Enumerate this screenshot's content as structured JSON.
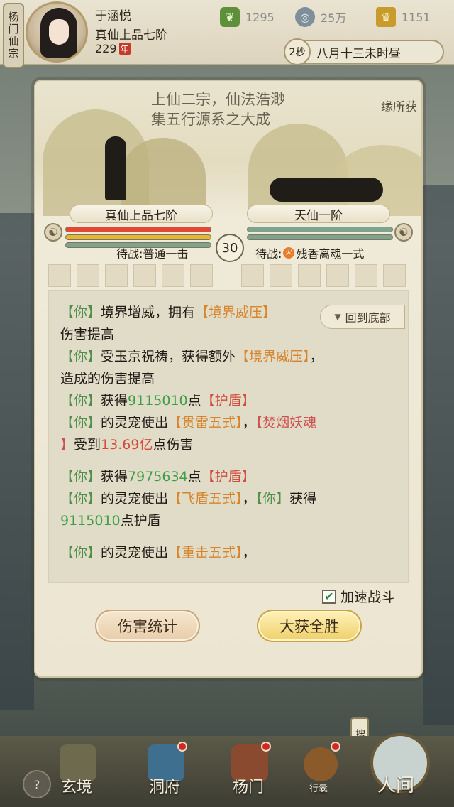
{
  "header": {
    "sect_tag": "杨门仙宗",
    "player_name": "于涵悦",
    "player_rank": "真仙上品七阶",
    "player_age": "229",
    "player_age_unit": "年",
    "resources": [
      {
        "icon": "leaf-icon",
        "value": "1295"
      },
      {
        "icon": "coin-icon",
        "value": "25万"
      },
      {
        "icon": "ingot-icon",
        "value": "1151"
      }
    ],
    "speed_label": "2秒",
    "game_time": "八月十三未时昼"
  },
  "battle": {
    "scene_title_1": "上仙二宗，仙法浩渺",
    "scene_title_2": "集五行源系之大成",
    "scene_side_text": "缘所获",
    "left_fighter": "真仙上品七阶",
    "right_fighter": "天仙一阶",
    "round": "30",
    "left_pending": "待战:普通一击",
    "right_pending_prefix": "待战:",
    "right_pending_icon": "火",
    "right_pending_skill": "残香离魂一式",
    "colors": {
      "hp_red": "#e04a34",
      "hp_yellow": "#e8b530",
      "mp_green": "#7fa48e",
      "log_green": "#4f8f4a",
      "log_orange": "#d7852c",
      "log_red": "#cf5050"
    }
  },
  "log": {
    "back_to_bottom": "回到底部",
    "l1_you": "【你】",
    "l1_text": "境界增威，拥有",
    "l1_skill": "【境界威压】",
    "l2_text": "伤害提高",
    "l3_you": "【你】",
    "l3_text": "受玉京祝祷，获得额外",
    "l3_skill": "【境界威压】",
    "l3_end": "，",
    "l4_text": "造成的伤害提高",
    "l5_you": "【你】",
    "l5_text": "获得",
    "l5_num": "9115010",
    "l5_text2": "点",
    "l5_shield": "【护盾】",
    "l6_you": "【你】",
    "l6_text": "的灵宠使出",
    "l6_skill": "【贯雷五式】",
    "l6_sep": "，",
    "l6_enemy": "【焚烟妖魂",
    "l7_enemy": "】",
    "l7_text": "受到",
    "l7_num": "13.69亿",
    "l7_text2": "点伤害",
    "l8_you": "【你】",
    "l8_text": "获得",
    "l8_num": "7975634",
    "l8_text2": "点",
    "l8_shield": "【护盾】",
    "l9_you": "【你】",
    "l9_text": "的灵宠使出",
    "l9_skill": "【飞盾五式】",
    "l9_sep": "，",
    "l9_you2": "【你】",
    "l9_text2": "获得",
    "l10_num": "9115010",
    "l10_text": "点护盾",
    "l11_you": "【你】",
    "l11_text": "的灵宠使出",
    "l11_skill": "【重击五式】",
    "l11_sep": "，"
  },
  "controls": {
    "speed_label": "加速战斗",
    "speed_checked": true,
    "damage_stats": "伤害统计",
    "victory": "大获全胜"
  },
  "bottom_nav": {
    "search_tag": "搜救中",
    "items": [
      {
        "label": "玄境",
        "icon": "mystic-realm-icon"
      },
      {
        "label": "洞府",
        "icon": "cave-dwelling-icon"
      },
      {
        "label": "杨门",
        "icon": "sect-gate-icon"
      },
      {
        "label": "行囊",
        "icon": "bag-icon"
      },
      {
        "label": "人间",
        "icon": "world-icon"
      }
    ],
    "chat_badge": "?"
  }
}
